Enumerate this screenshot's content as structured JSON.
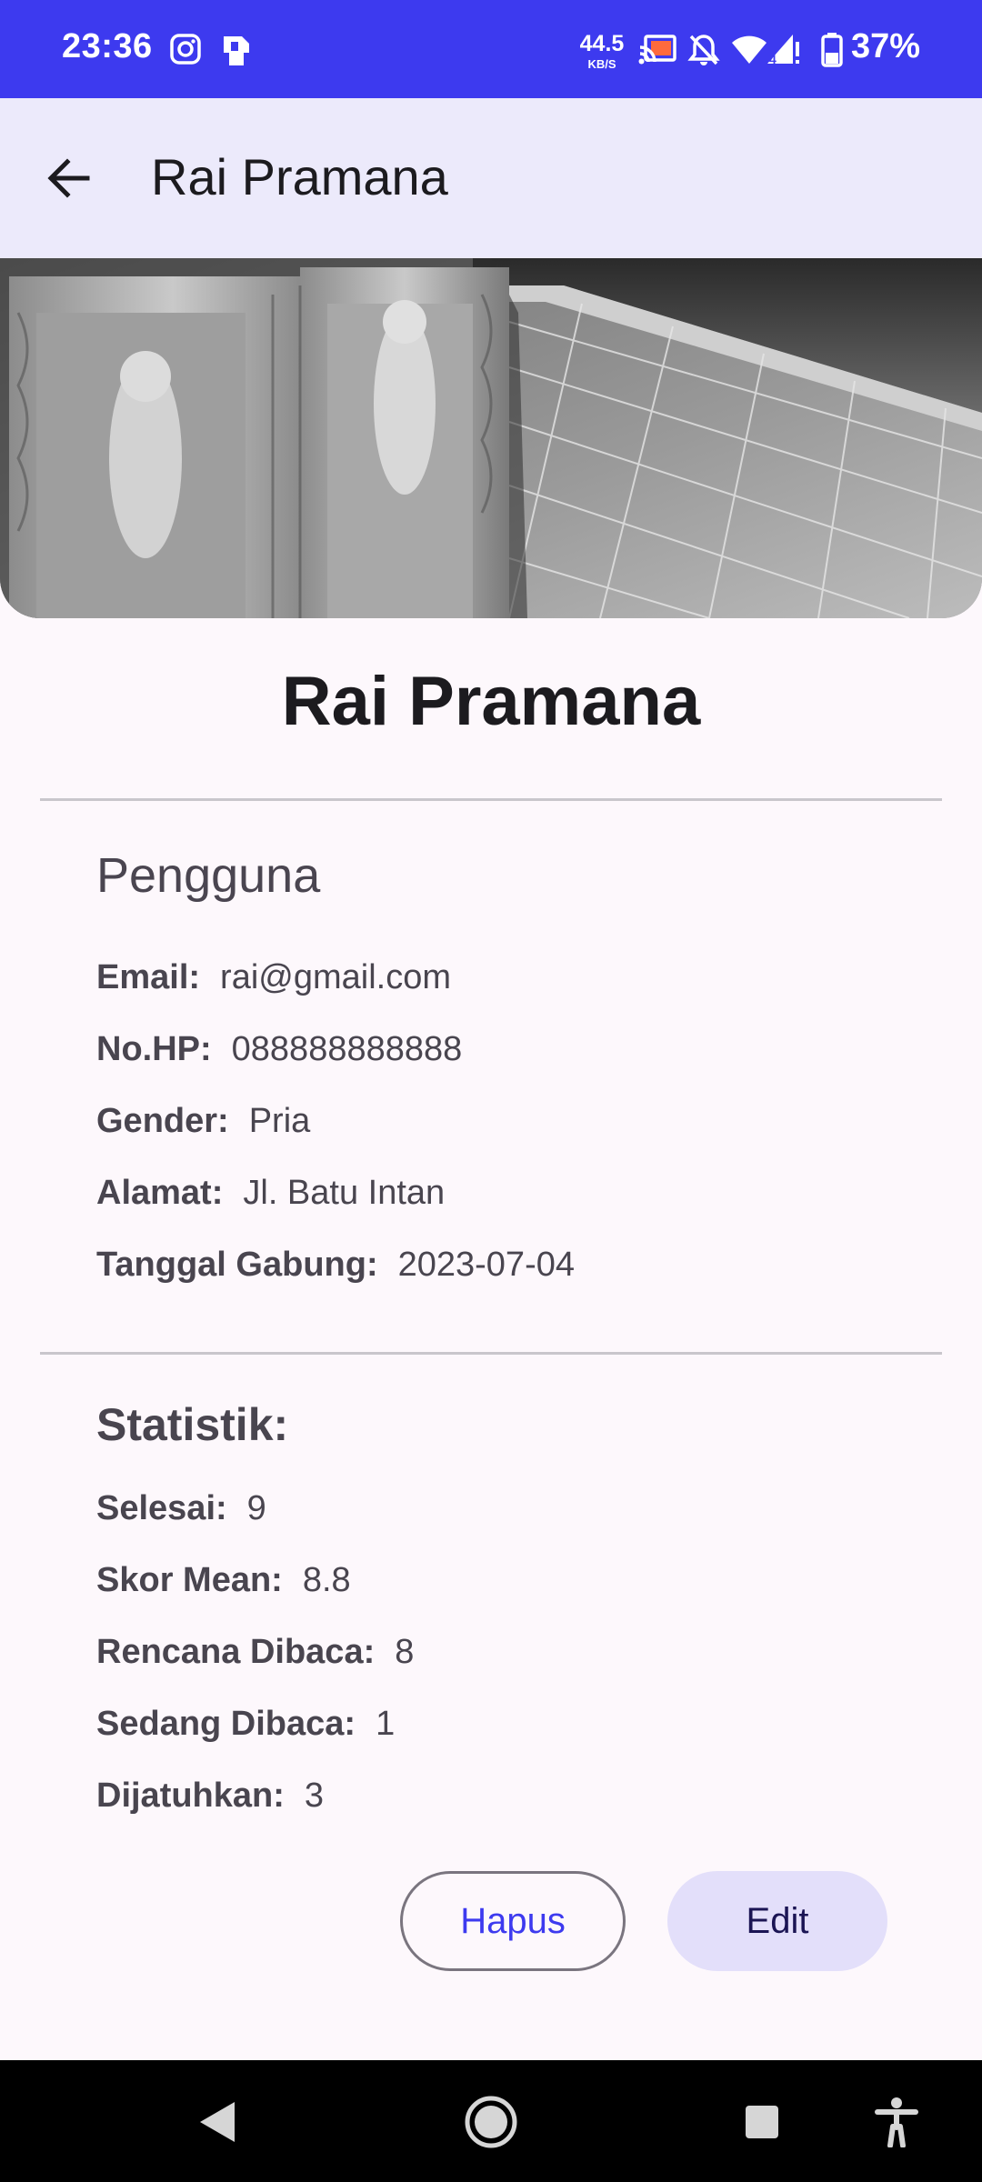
{
  "status_bar": {
    "time": "23:36",
    "net_speed": "44.5",
    "net_unit": "KB/S",
    "battery": "37%",
    "icons": [
      "instagram-icon",
      "sim-card-icon",
      "cast-icon",
      "mute-icon",
      "wifi-icon",
      "signal-icon",
      "battery-icon"
    ],
    "color": "#3d3aef"
  },
  "app_bar": {
    "title": "Rai Pramana",
    "back_icon": "arrow-back-icon"
  },
  "profile": {
    "name": "Rai Pramana",
    "role": "Pengguna",
    "fields": [
      {
        "label": "Email:",
        "value": "rai@gmail.com"
      },
      {
        "label": "No.HP:",
        "value": "088888888888"
      },
      {
        "label": "Gender:",
        "value": "Pria"
      },
      {
        "label": "Alamat:",
        "value": "Jl. Batu Intan"
      },
      {
        "label": "Tanggal Gabung:",
        "value": "2023-07-04"
      }
    ]
  },
  "stats": {
    "title": "Statistik:",
    "items": [
      {
        "label": "Selesai:",
        "value": "9"
      },
      {
        "label": "Skor Mean:",
        "value": "8.8"
      },
      {
        "label": "Rencana Dibaca:",
        "value": "8"
      },
      {
        "label": "Sedang Dibaca:",
        "value": "1"
      },
      {
        "label": "Dijatuhkan:",
        "value": "3"
      }
    ]
  },
  "actions": {
    "delete_label": "Hapus",
    "edit_label": "Edit"
  },
  "nav_bar": {
    "icons": [
      "nav-back-icon",
      "nav-home-icon",
      "nav-recents-icon",
      "accessibility-icon"
    ]
  }
}
